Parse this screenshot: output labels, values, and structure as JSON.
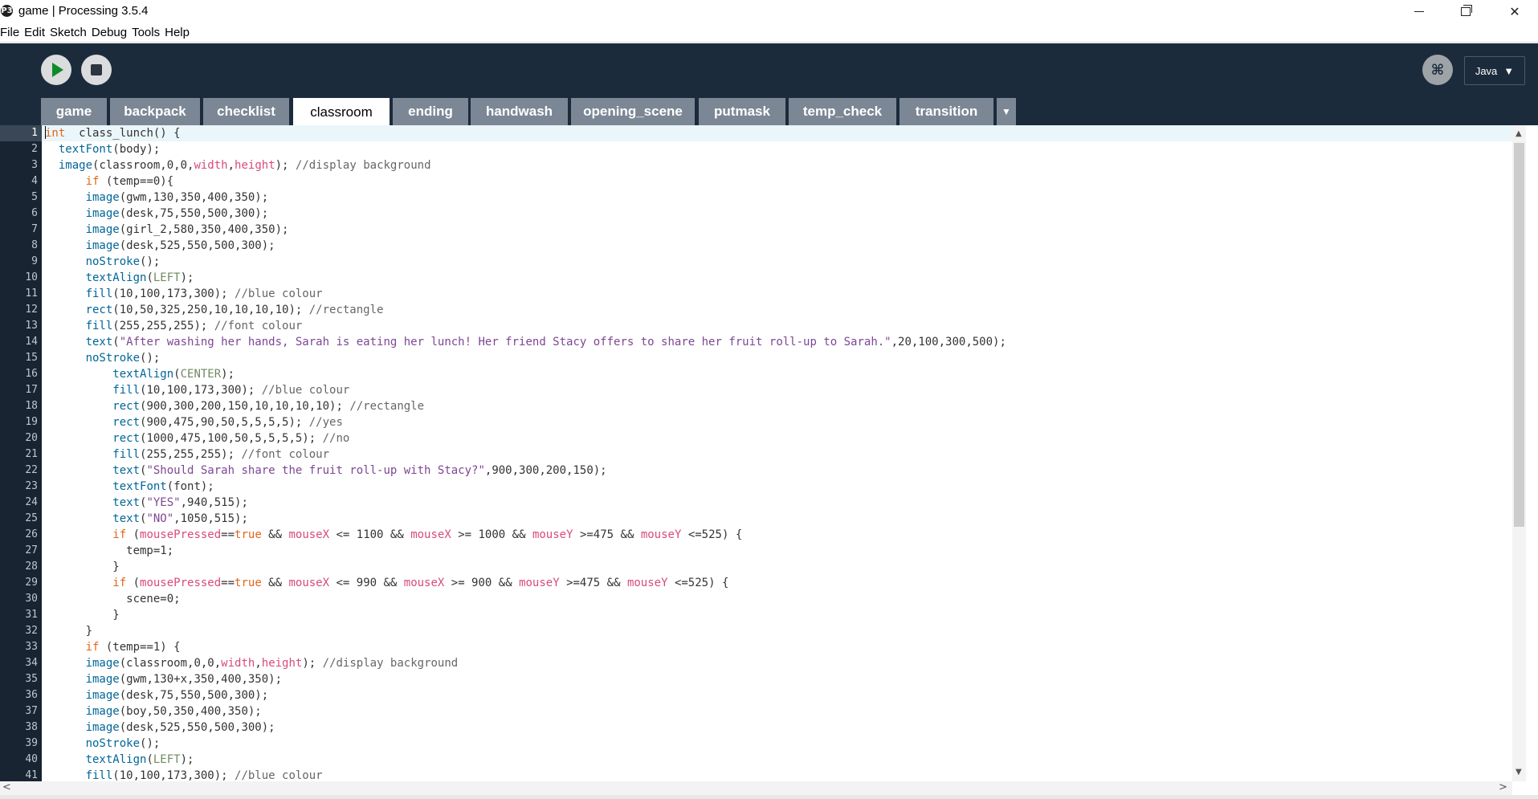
{
  "window": {
    "title": "game | Processing 3.5.4",
    "icon_text": "P3",
    "minimize": "minimize",
    "maximize": "restore",
    "close": "close"
  },
  "menu": [
    "File",
    "Edit",
    "Sketch",
    "Debug",
    "Tools",
    "Help"
  ],
  "toolbar": {
    "run_icon": "play-icon",
    "stop_icon": "stop-icon",
    "debug_icon": "debugger-icon",
    "mode_label": "Java",
    "mode_caret": "▼"
  },
  "tabs": [
    {
      "label": "game",
      "active": false
    },
    {
      "label": "backpack",
      "active": false
    },
    {
      "label": "checklist",
      "active": false
    },
    {
      "label": "classroom",
      "active": true
    },
    {
      "label": "ending",
      "active": false
    },
    {
      "label": "handwash",
      "active": false
    },
    {
      "label": "opening_scene",
      "active": false
    },
    {
      "label": "putmask",
      "active": false
    },
    {
      "label": "temp_check",
      "active": false
    },
    {
      "label": "transition",
      "active": false
    }
  ],
  "tab_menu_icon": "▼",
  "colors": {
    "toolbar_bg": "#1b2b3c",
    "tab_bg": "#7c8795",
    "keyword": "#e2661a",
    "function": "#006699",
    "constant": "#718a62",
    "variable": "#d94a7a",
    "string": "#7d4793",
    "comment": "#666666"
  },
  "editor": {
    "current_line": 1,
    "lines": [
      [
        [
          "kw",
          "int"
        ],
        [
          "",
          "  class_lunch() {"
        ]
      ],
      [
        [
          "",
          "  "
        ],
        [
          "fn",
          "textFont"
        ],
        [
          "",
          "(body);"
        ]
      ],
      [
        [
          "",
          "  "
        ],
        [
          "fn",
          "image"
        ],
        [
          "",
          "(classroom,0,0,"
        ],
        [
          "va",
          "width"
        ],
        [
          "",
          ","
        ],
        [
          "va",
          "height"
        ],
        [
          "",
          "); "
        ],
        [
          "cm",
          "//display background"
        ]
      ],
      [
        [
          "",
          "      "
        ],
        [
          "kw",
          "if"
        ],
        [
          "",
          " (temp==0){"
        ]
      ],
      [
        [
          "",
          "      "
        ],
        [
          "fn",
          "image"
        ],
        [
          "",
          "(gwm,130,350,400,350);"
        ]
      ],
      [
        [
          "",
          "      "
        ],
        [
          "fn",
          "image"
        ],
        [
          "",
          "(desk,75,550,500,300);"
        ]
      ],
      [
        [
          "",
          "      "
        ],
        [
          "fn",
          "image"
        ],
        [
          "",
          "(girl_2,580,350,400,350);"
        ]
      ],
      [
        [
          "",
          "      "
        ],
        [
          "fn",
          "image"
        ],
        [
          "",
          "(desk,525,550,500,300);"
        ]
      ],
      [
        [
          "",
          "      "
        ],
        [
          "fn",
          "noStroke"
        ],
        [
          "",
          "();"
        ]
      ],
      [
        [
          "",
          "      "
        ],
        [
          "fn",
          "textAlign"
        ],
        [
          "",
          "("
        ],
        [
          "cn",
          "LEFT"
        ],
        [
          "",
          ");"
        ]
      ],
      [
        [
          "",
          "      "
        ],
        [
          "fn",
          "fill"
        ],
        [
          "",
          "(10,100,173,300); "
        ],
        [
          "cm",
          "//blue colour"
        ]
      ],
      [
        [
          "",
          "      "
        ],
        [
          "fn",
          "rect"
        ],
        [
          "",
          "(10,50,325,250,10,10,10,10); "
        ],
        [
          "cm",
          "//rectangle"
        ]
      ],
      [
        [
          "",
          "      "
        ],
        [
          "fn",
          "fill"
        ],
        [
          "",
          "(255,255,255); "
        ],
        [
          "cm",
          "//font colour"
        ]
      ],
      [
        [
          "",
          "      "
        ],
        [
          "fn",
          "text"
        ],
        [
          "",
          "("
        ],
        [
          "st",
          "\"After washing her hands, Sarah is eating her lunch! Her friend Stacy offers to share her fruit roll-up to Sarah.\""
        ],
        [
          "",
          ",20,100,300,500);"
        ]
      ],
      [
        [
          "",
          "      "
        ],
        [
          "fn",
          "noStroke"
        ],
        [
          "",
          "();"
        ]
      ],
      [
        [
          "",
          "          "
        ],
        [
          "fn",
          "textAlign"
        ],
        [
          "",
          "("
        ],
        [
          "cn",
          "CENTER"
        ],
        [
          "",
          ");"
        ]
      ],
      [
        [
          "",
          "          "
        ],
        [
          "fn",
          "fill"
        ],
        [
          "",
          "(10,100,173,300); "
        ],
        [
          "cm",
          "//blue colour"
        ]
      ],
      [
        [
          "",
          "          "
        ],
        [
          "fn",
          "rect"
        ],
        [
          "",
          "(900,300,200,150,10,10,10,10); "
        ],
        [
          "cm",
          "//rectangle"
        ]
      ],
      [
        [
          "",
          "          "
        ],
        [
          "fn",
          "rect"
        ],
        [
          "",
          "(900,475,90,50,5,5,5,5); "
        ],
        [
          "cm",
          "//yes"
        ]
      ],
      [
        [
          "",
          "          "
        ],
        [
          "fn",
          "rect"
        ],
        [
          "",
          "(1000,475,100,50,5,5,5,5); "
        ],
        [
          "cm",
          "//no"
        ]
      ],
      [
        [
          "",
          "          "
        ],
        [
          "fn",
          "fill"
        ],
        [
          "",
          "(255,255,255); "
        ],
        [
          "cm",
          "//font colour"
        ]
      ],
      [
        [
          "",
          "          "
        ],
        [
          "fn",
          "text"
        ],
        [
          "",
          "("
        ],
        [
          "st",
          "\"Should Sarah share the fruit roll-up with Stacy?\""
        ],
        [
          "",
          ",900,300,200,150);"
        ]
      ],
      [
        [
          "",
          "          "
        ],
        [
          "fn",
          "textFont"
        ],
        [
          "",
          "(font);"
        ]
      ],
      [
        [
          "",
          "          "
        ],
        [
          "fn",
          "text"
        ],
        [
          "",
          "("
        ],
        [
          "st",
          "\"YES\""
        ],
        [
          "",
          ",940,515);"
        ]
      ],
      [
        [
          "",
          "          "
        ],
        [
          "fn",
          "text"
        ],
        [
          "",
          "("
        ],
        [
          "st",
          "\"NO\""
        ],
        [
          "",
          ",1050,515);"
        ]
      ],
      [
        [
          "",
          "          "
        ],
        [
          "kw",
          "if"
        ],
        [
          "",
          " ("
        ],
        [
          "va",
          "mousePressed"
        ],
        [
          "",
          "=="
        ],
        [
          "kw",
          "true"
        ],
        [
          "",
          " && "
        ],
        [
          "va",
          "mouseX"
        ],
        [
          "",
          " <= 1100 && "
        ],
        [
          "va",
          "mouseX"
        ],
        [
          "",
          " >= 1000 && "
        ],
        [
          "va",
          "mouseY"
        ],
        [
          "",
          " >=475 && "
        ],
        [
          "va",
          "mouseY"
        ],
        [
          "",
          " <=525) {"
        ]
      ],
      [
        [
          "",
          "            temp=1;"
        ]
      ],
      [
        [
          "",
          "          }"
        ]
      ],
      [
        [
          "",
          "          "
        ],
        [
          "kw",
          "if"
        ],
        [
          "",
          " ("
        ],
        [
          "va",
          "mousePressed"
        ],
        [
          "",
          "=="
        ],
        [
          "kw",
          "true"
        ],
        [
          "",
          " && "
        ],
        [
          "va",
          "mouseX"
        ],
        [
          "",
          " <= 990 && "
        ],
        [
          "va",
          "mouseX"
        ],
        [
          "",
          " >= 900 && "
        ],
        [
          "va",
          "mouseY"
        ],
        [
          "",
          " >=475 && "
        ],
        [
          "va",
          "mouseY"
        ],
        [
          "",
          " <=525) {"
        ]
      ],
      [
        [
          "",
          "            scene=0;"
        ]
      ],
      [
        [
          "",
          "          }"
        ]
      ],
      [
        [
          "",
          "      }"
        ]
      ],
      [
        [
          "",
          "      "
        ],
        [
          "kw",
          "if"
        ],
        [
          "",
          " (temp==1) {"
        ]
      ],
      [
        [
          "",
          "      "
        ],
        [
          "fn",
          "image"
        ],
        [
          "",
          "(classroom,0,0,"
        ],
        [
          "va",
          "width"
        ],
        [
          "",
          ","
        ],
        [
          "va",
          "height"
        ],
        [
          "",
          "); "
        ],
        [
          "cm",
          "//display background"
        ]
      ],
      [
        [
          "",
          "      "
        ],
        [
          "fn",
          "image"
        ],
        [
          "",
          "(gwm,130+x,350,400,350);"
        ]
      ],
      [
        [
          "",
          "      "
        ],
        [
          "fn",
          "image"
        ],
        [
          "",
          "(desk,75,550,500,300);"
        ]
      ],
      [
        [
          "",
          "      "
        ],
        [
          "fn",
          "image"
        ],
        [
          "",
          "(boy,50,350,400,350);"
        ]
      ],
      [
        [
          "",
          "      "
        ],
        [
          "fn",
          "image"
        ],
        [
          "",
          "(desk,525,550,500,300);"
        ]
      ],
      [
        [
          "",
          "      "
        ],
        [
          "fn",
          "noStroke"
        ],
        [
          "",
          "();"
        ]
      ],
      [
        [
          "",
          "      "
        ],
        [
          "fn",
          "textAlign"
        ],
        [
          "",
          "("
        ],
        [
          "cn",
          "LEFT"
        ],
        [
          "",
          ");"
        ]
      ],
      [
        [
          "",
          "      "
        ],
        [
          "fn",
          "fill"
        ],
        [
          "",
          "(10,100,173,300); "
        ],
        [
          "cm",
          "//blue colour"
        ]
      ]
    ]
  },
  "scrollbars": {
    "up": "▲",
    "down": "▼",
    "left": "<",
    "right": ">"
  }
}
